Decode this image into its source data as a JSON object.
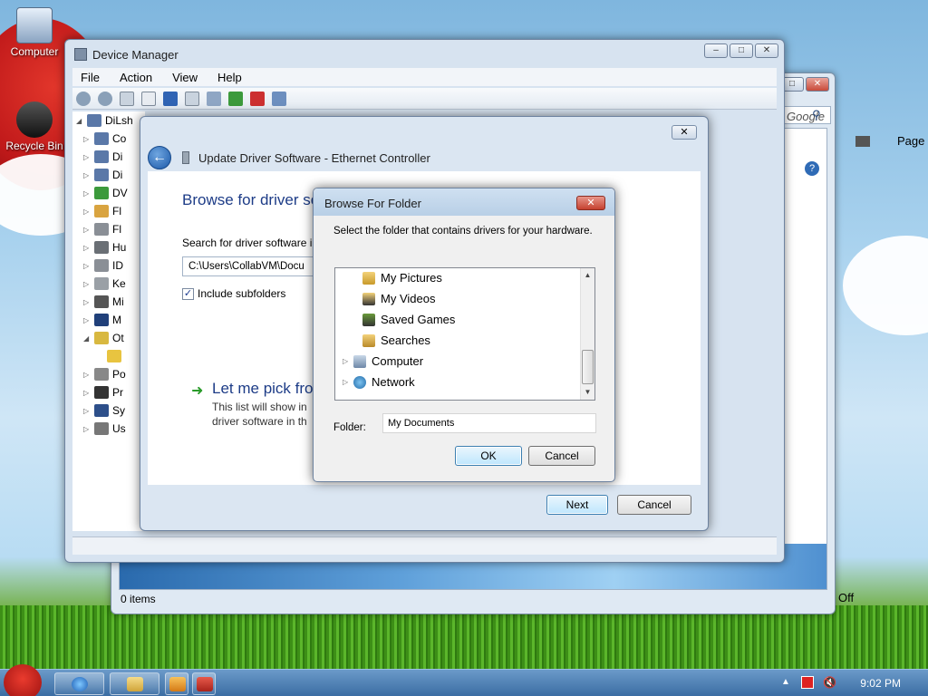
{
  "desktop": {
    "icons": [
      {
        "label": "Computer"
      },
      {
        "label": "Recycle Bin"
      }
    ]
  },
  "explorer_back": {
    "search_placeholder": "Google",
    "page_label": "Page",
    "status_items": "0 items",
    "off_label": "Off"
  },
  "device_manager": {
    "title": "Device Manager",
    "menu": [
      "File",
      "Action",
      "View",
      "Help"
    ],
    "tree_root": "DiLsh",
    "tree_items": [
      "Co",
      "Di",
      "Di",
      "DV",
      "Fl",
      "Fl",
      "Hu",
      "ID",
      "Ke",
      "Mi",
      "M",
      "Ot",
      "",
      "Po",
      "Pr",
      "Sy",
      "Us"
    ]
  },
  "wizard": {
    "title": "Update Driver Software - Ethernet Controller",
    "heading": "Browse for driver so",
    "search_label": "Search for driver software in",
    "path_value": "C:\\Users\\CollabVM\\Docu",
    "include_subfolders": "Include subfolders",
    "pick_heading": "Let me pick fro",
    "pick_desc_1": "This list will show in",
    "pick_desc_2": "driver software in th",
    "next": "Next",
    "cancel": "Cancel"
  },
  "browse_folder": {
    "title": "Browse For Folder",
    "prompt": "Select the folder that contains drivers for your hardware.",
    "items": [
      "My Pictures",
      "My Videos",
      "Saved Games",
      "Searches",
      "Computer",
      "Network"
    ],
    "folder_label": "Folder:",
    "folder_value": "My Documents",
    "ok": "OK",
    "cancel": "Cancel"
  },
  "taskbar": {
    "clock": "9:02 PM"
  },
  "colors": {
    "heading_blue": "#1d3c87",
    "taskbar": "#3b6da3",
    "close_red": "#c5402f"
  }
}
